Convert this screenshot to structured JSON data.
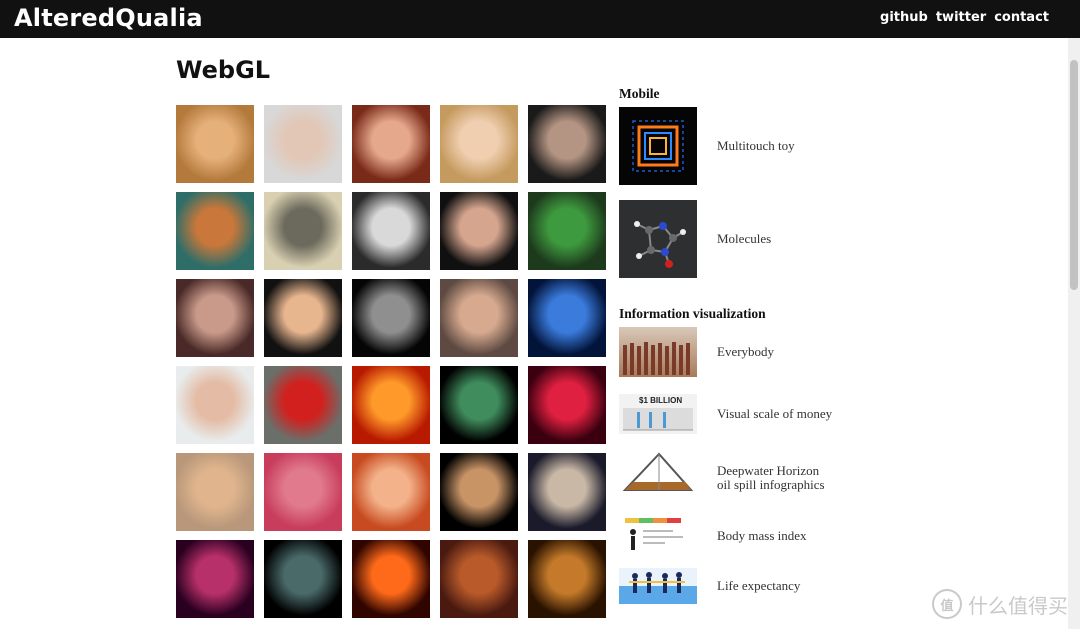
{
  "header": {
    "logo": "AlteredQualia",
    "nav": [
      {
        "label": "github"
      },
      {
        "label": "twitter"
      },
      {
        "label": "contact"
      }
    ]
  },
  "main": {
    "title": "WebGL",
    "thumbnails": [
      {
        "name": "venus-face",
        "bg": "#b47a3c",
        "fg": "#e6b07a"
      },
      {
        "name": "female-face-pale",
        "bg": "#d8d8d8",
        "fg": "#e2c7b7"
      },
      {
        "name": "woman-red-hair",
        "bg": "#7a2a18",
        "fg": "#e5a88c"
      },
      {
        "name": "blonde-woman",
        "bg": "#c59a5e",
        "fg": "#f0cfb1"
      },
      {
        "name": "bald-man-dark",
        "bg": "#1a1a1a",
        "fg": "#b49482"
      },
      {
        "name": "van-gogh-portrait",
        "bg": "#2f6e68",
        "fg": "#c9773a"
      },
      {
        "name": "drawn-man-portrait",
        "bg": "#d9d0b2",
        "fg": "#6c6a5c"
      },
      {
        "name": "einstein-photo",
        "bg": "#2b2b2b",
        "fg": "#d9d9d9"
      },
      {
        "name": "old-bald-head",
        "bg": "#101010",
        "fg": "#d6a58e"
      },
      {
        "name": "green-face",
        "bg": "#1d3a1d",
        "fg": "#3e9a3e"
      },
      {
        "name": "green-eyed-woman",
        "bg": "#4a2a28",
        "fg": "#c99a8a"
      },
      {
        "name": "smiling-woman",
        "bg": "#111111",
        "fg": "#e7b58e"
      },
      {
        "name": "shadow-face",
        "bg": "#050505",
        "fg": "#8f8f8f"
      },
      {
        "name": "head-closeup",
        "bg": "#5e4a42",
        "fg": "#d7aa8f"
      },
      {
        "name": "space-head",
        "bg": "#02143a",
        "fg": "#3a7bdc"
      },
      {
        "name": "brunette-woman",
        "bg": "#e8ecec",
        "fg": "#e4bba4"
      },
      {
        "name": "red-car",
        "bg": "#6a6f6a",
        "fg": "#d2201e"
      },
      {
        "name": "fire-figures",
        "bg": "#b81a00",
        "fg": "#ff9a2a"
      },
      {
        "name": "earth-globe",
        "bg": "#000000",
        "fg": "#3f8c5c"
      },
      {
        "name": "red-particles",
        "bg": "#3a0010",
        "fg": "#e02040"
      },
      {
        "name": "persian-cat",
        "bg": "#b8977a",
        "fg": "#e0b58d"
      },
      {
        "name": "red-crystals",
        "bg": "#c83c5c",
        "fg": "#e07a8c"
      },
      {
        "name": "red-rock-canyon",
        "bg": "#c84a20",
        "fg": "#f3b28a"
      },
      {
        "name": "jupiter",
        "bg": "#000000",
        "fg": "#c89466"
      },
      {
        "name": "dancing-man",
        "bg": "#1a1a2a",
        "fg": "#c9b8a6"
      },
      {
        "name": "magenta-orb",
        "bg": "#2a0020",
        "fg": "#b8306a"
      },
      {
        "name": "dark-earth",
        "bg": "#000000",
        "fg": "#4a6a6a"
      },
      {
        "name": "glowing-doorway",
        "bg": "#300500",
        "fg": "#ff6a1a"
      },
      {
        "name": "robot-warrior",
        "bg": "#4a1a10",
        "fg": "#b85a2a"
      },
      {
        "name": "ornate-face",
        "bg": "#2a1200",
        "fg": "#c47a2a"
      }
    ]
  },
  "sidebar": {
    "mobile": {
      "title": "Mobile",
      "items": [
        {
          "label": "Multitouch toy"
        },
        {
          "label": "Molecules"
        }
      ]
    },
    "infovis": {
      "title": "Information visualization",
      "items": [
        {
          "label": "Everybody"
        },
        {
          "label": "Visual scale of money",
          "thumb_caption": "$1 BILLION"
        },
        {
          "label_line1": "Deepwater Horizon",
          "label_line2": "oil spill infographics"
        },
        {
          "label": "Body mass index"
        },
        {
          "label": "Life expectancy"
        }
      ]
    }
  },
  "watermark": {
    "badge": "值",
    "text": "什么值得买"
  }
}
